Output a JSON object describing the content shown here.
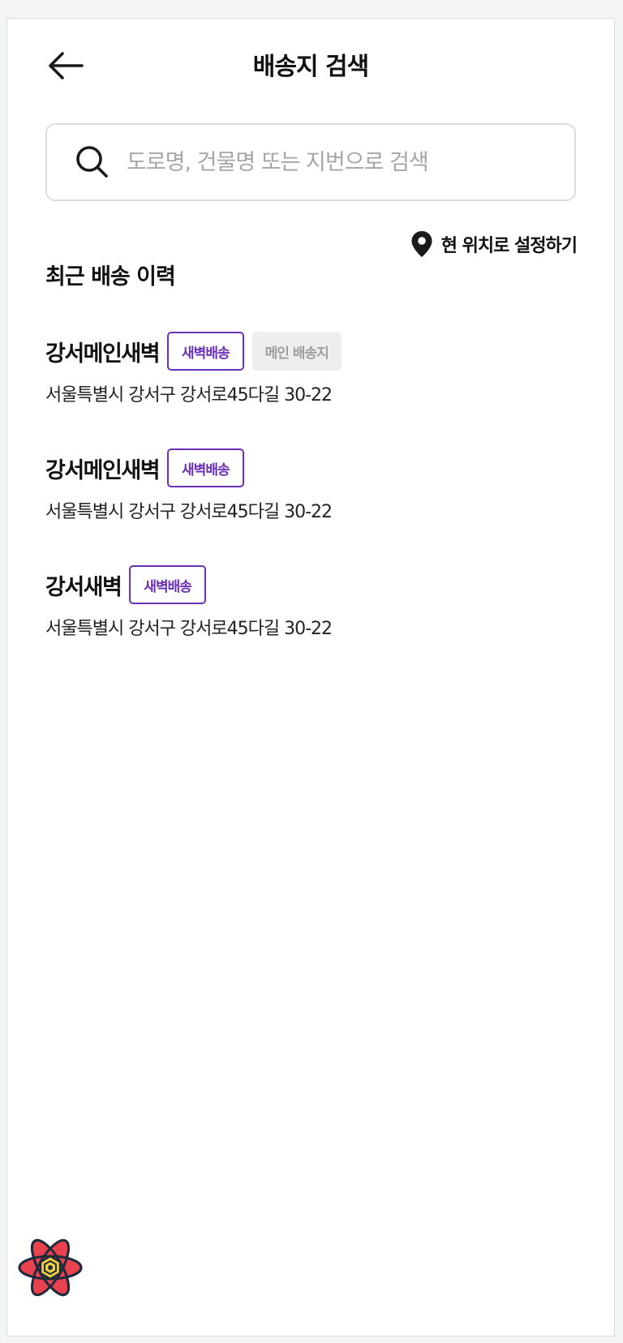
{
  "header": {
    "title": "배송지 검색",
    "back_icon": "arrow-left-icon"
  },
  "search": {
    "placeholder": "도로명, 건물명 또는 지번으로 검색",
    "value": "",
    "icon": "search-icon"
  },
  "location": {
    "label": "현 위치로 설정하기",
    "icon": "map-pin-icon"
  },
  "recent": {
    "title": "최근 배송 이력",
    "items": [
      {
        "name": "강서메인새벽",
        "tags": [
          "새벽배송",
          "메인 배송지"
        ],
        "address": "서울특별시 강서구 강서로45다길 30-22"
      },
      {
        "name": "강서메인새벽",
        "tags": [
          "새벽배송"
        ],
        "address": "서울특별시 강서구 강서로45다길 30-22"
      },
      {
        "name": "강서새벽",
        "tags": [
          "새벽배송"
        ],
        "address": "서울특별시 강서구 강서로45다길 30-22"
      }
    ]
  },
  "colors": {
    "accent_purple": "#6b2fb8",
    "tag_gray_bg": "#eeeeee",
    "tag_gray_text": "#9d9d9d",
    "border": "#dddddd"
  },
  "logo_icon": "react-atom-logo-icon"
}
